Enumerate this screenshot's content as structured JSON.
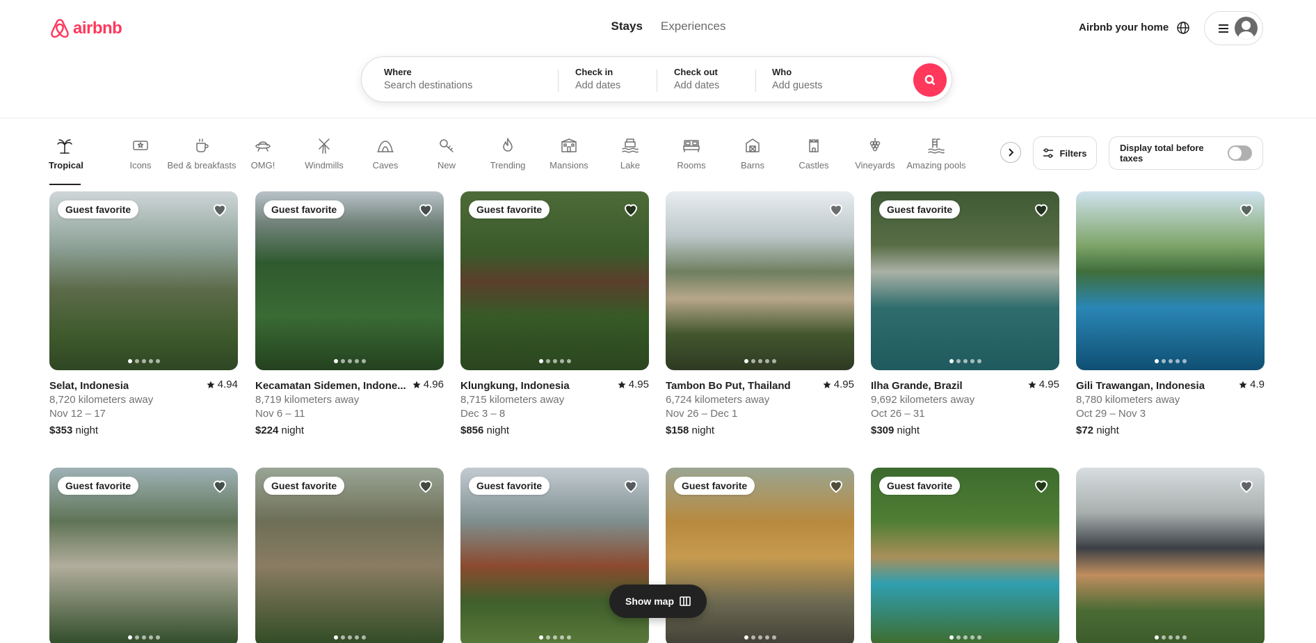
{
  "brand": {
    "name": "airbnb",
    "color": "#ff385c"
  },
  "nav": {
    "stays": "Stays",
    "experiences": "Experiences"
  },
  "header_right": {
    "host": "Airbnb your home"
  },
  "search": {
    "where": {
      "label": "Where",
      "placeholder": "Search destinations"
    },
    "check_in": {
      "label": "Check in",
      "placeholder": "Add dates"
    },
    "check_out": {
      "label": "Check out",
      "placeholder": "Add dates"
    },
    "who": {
      "label": "Who",
      "placeholder": "Add guests"
    }
  },
  "categories": [
    {
      "label": "Tropical",
      "icon": "palm-tree-icon",
      "active": true
    },
    {
      "label": "Icons",
      "icon": "ticket-icon"
    },
    {
      "label": "Bed & breakfasts",
      "icon": "coffee-icon"
    },
    {
      "label": "OMG!",
      "icon": "ufo-icon"
    },
    {
      "label": "Windmills",
      "icon": "windmill-icon"
    },
    {
      "label": "Caves",
      "icon": "cave-icon"
    },
    {
      "label": "New",
      "icon": "key-icon"
    },
    {
      "label": "Trending",
      "icon": "flame-icon"
    },
    {
      "label": "Mansions",
      "icon": "mansion-icon"
    },
    {
      "label": "Lake",
      "icon": "lake-icon"
    },
    {
      "label": "Rooms",
      "icon": "bed-icon"
    },
    {
      "label": "Barns",
      "icon": "barn-icon"
    },
    {
      "label": "Castles",
      "icon": "castle-icon"
    },
    {
      "label": "Vineyards",
      "icon": "grapes-icon"
    },
    {
      "label": "Amazing pools",
      "icon": "pool-icon"
    }
  ],
  "filters": {
    "label": "Filters"
  },
  "tax_toggle": {
    "label": "Display total before taxes",
    "on": false
  },
  "listings": [
    {
      "badge": "Guest favorite",
      "location": "Selat, Indonesia",
      "rating": "4.94",
      "distance": "8,720 kilometers away",
      "dates": "Nov 12 – 17",
      "price": "$353",
      "unit": "night"
    },
    {
      "badge": "Guest favorite",
      "location": "Kecamatan Sidemen, Indone...",
      "rating": "4.96",
      "distance": "8,719 kilometers away",
      "dates": "Nov 6 – 11",
      "price": "$224",
      "unit": "night"
    },
    {
      "badge": "Guest favorite",
      "location": "Klungkung, Indonesia",
      "rating": "4.95",
      "distance": "8,715 kilometers away",
      "dates": "Dec 3 – 8",
      "price": "$856",
      "unit": "night"
    },
    {
      "badge": "",
      "location": "Tambon Bo Put, Thailand",
      "rating": "4.95",
      "distance": "6,724 kilometers away",
      "dates": "Nov 26 – Dec 1",
      "price": "$158",
      "unit": "night"
    },
    {
      "badge": "Guest favorite",
      "location": "Ilha Grande, Brazil",
      "rating": "4.95",
      "distance": "9,692 kilometers away",
      "dates": "Oct 26 – 31",
      "price": "$309",
      "unit": "night"
    },
    {
      "badge": "",
      "location": "Gili Trawangan, Indonesia",
      "rating": "4.9",
      "distance": "8,780 kilometers away",
      "dates": "Oct 29 – Nov 3",
      "price": "$72",
      "unit": "night"
    },
    {
      "badge": "Guest favorite"
    },
    {
      "badge": "Guest favorite"
    },
    {
      "badge": "Guest favorite"
    },
    {
      "badge": "Guest favorite"
    },
    {
      "badge": "Guest favorite"
    },
    {
      "badge": ""
    }
  ],
  "map_button": {
    "label": "Show map"
  }
}
